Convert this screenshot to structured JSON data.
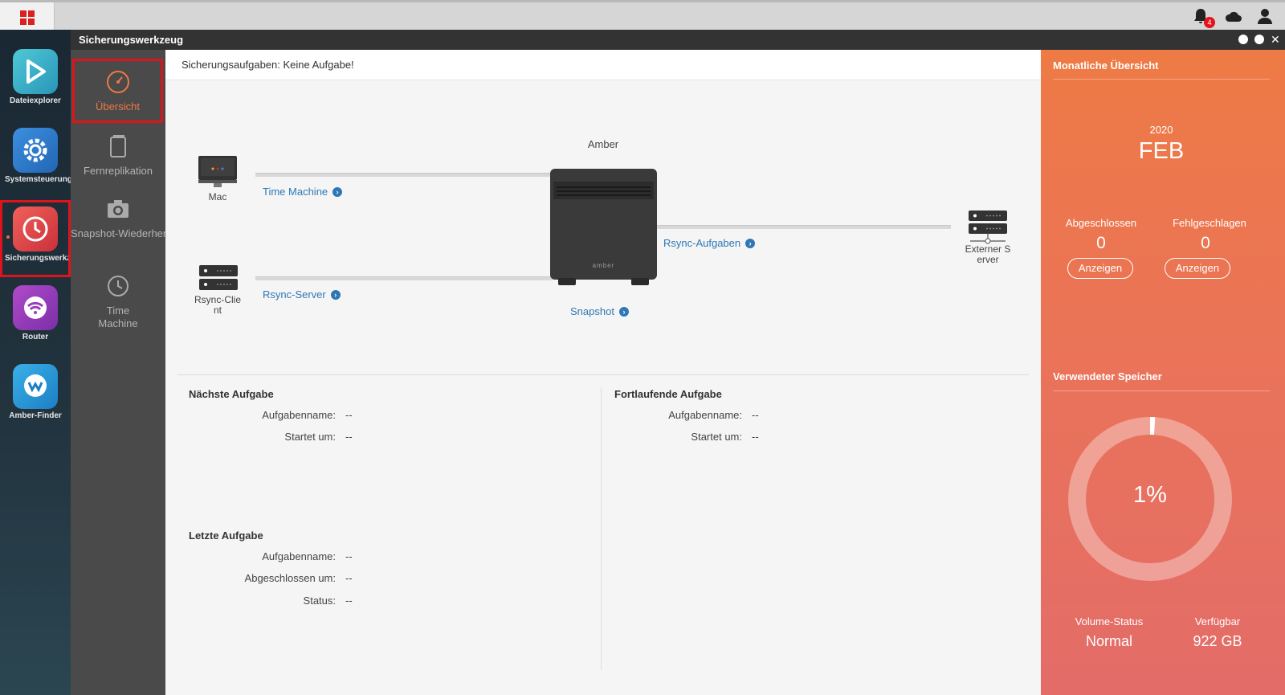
{
  "topbar": {
    "notification_count": "4"
  },
  "dock": [
    {
      "label": "Dateiexplorer",
      "icon": "file-explorer-icon"
    },
    {
      "label": "Systemsteuerung",
      "icon": "control-panel-icon"
    },
    {
      "label": "Sicherungswerkzeug",
      "icon": "backup-tool-icon"
    },
    {
      "label": "Router",
      "icon": "router-icon"
    },
    {
      "label": "Amber-Finder",
      "icon": "amber-finder-icon"
    }
  ],
  "window": {
    "title": "Sicherungswerkzeug"
  },
  "sidenav": [
    {
      "label": "Übersicht",
      "icon": "speedometer-icon"
    },
    {
      "label": "Fernreplikation",
      "icon": "copy-icon"
    },
    {
      "label": "Snapshot-Wiederherstellung",
      "icon": "camera-icon"
    },
    {
      "label": "Time Machine",
      "icon": "clock-icon"
    }
  ],
  "main": {
    "header": "Sicherungsaufgaben: Keine Aufgabe!",
    "diagram": {
      "center_label": "Amber",
      "device_brand": "amber",
      "mac_label": "Mac",
      "rsync_client_label": "Rsync-Client",
      "external_server_label": "Externer Server",
      "link_time_machine": "Time Machine",
      "link_rsync_server": "Rsync-Server",
      "link_rsync_tasks": "Rsync-Aufgaben",
      "link_snapshot": "Snapshot"
    },
    "next_task": {
      "title": "Nächste Aufgabe",
      "name_label": "Aufgabenname:",
      "name_value": "--",
      "start_label": "Startet um:",
      "start_value": "--"
    },
    "running_task": {
      "title": "Fortlaufende Aufgabe",
      "name_label": "Aufgabenname:",
      "name_value": "--",
      "start_label": "Startet um:",
      "start_value": "--"
    },
    "last_task": {
      "title": "Letzte Aufgabe",
      "name_label": "Aufgabenname:",
      "name_value": "--",
      "finished_label": "Abgeschlossen um:",
      "finished_value": "--",
      "status_label": "Status:",
      "status_value": "--"
    }
  },
  "monthly": {
    "title": "Monatliche Übersicht",
    "year": "2020",
    "month": "FEB",
    "completed_label": "Abgeschlossen",
    "completed_value": "0",
    "failed_label": "Fehlgeschlagen",
    "failed_value": "0",
    "show_label": "Anzeigen"
  },
  "storage": {
    "title": "Verwendeter Speicher",
    "used_percent_text": "1%",
    "used_fraction": 0.01,
    "volume_status_label": "Volume-Status",
    "volume_status_value": "Normal",
    "available_label": "Verfügbar",
    "available_value": "922 GB"
  },
  "colors": {
    "accent": "#ef7843",
    "link": "#2e78b5",
    "highlight": "#e0121a"
  }
}
